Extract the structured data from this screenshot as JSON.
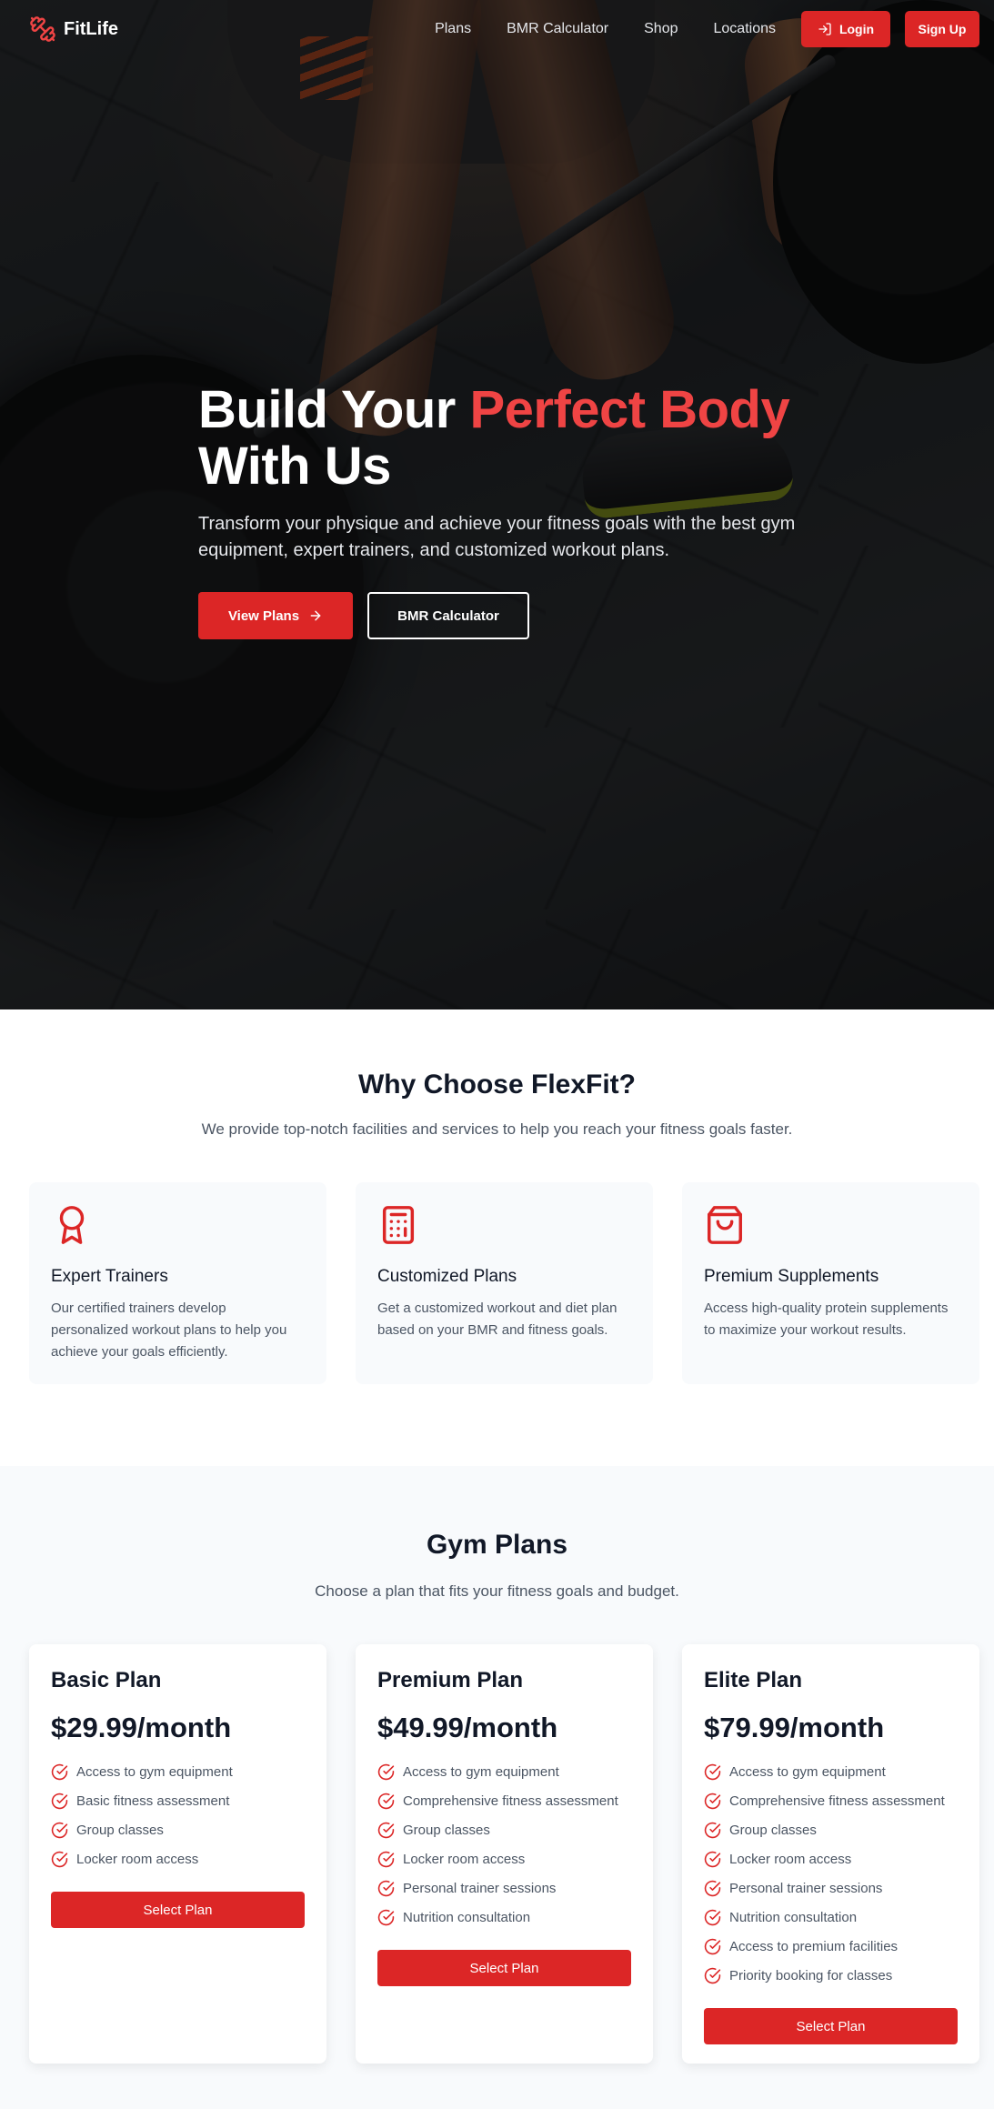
{
  "brand": {
    "name": "FitLife"
  },
  "nav": {
    "links": [
      "Plans",
      "BMR Calculator",
      "Shop",
      "Locations"
    ],
    "login_label": "Login",
    "signup_label": "Sign Up"
  },
  "hero": {
    "title_start": "Build Your ",
    "title_accent": "Perfect Body",
    "title_end": "With Us",
    "subtitle": "Transform your physique and achieve your fitness goals with the best gym equipment, expert trainers, and customized workout plans.",
    "primary_label": "View Plans",
    "secondary_label": "BMR Calculator"
  },
  "features": {
    "title": "Why Choose FlexFit?",
    "subtitle": "We provide top-notch facilities and services to help you reach your fitness goals faster.",
    "items": [
      {
        "icon": "award-icon",
        "title": "Expert Trainers",
        "desc": "Our certified trainers develop personalized workout plans to help you achieve your goals efficiently."
      },
      {
        "icon": "calculator-icon",
        "title": "Customized Plans",
        "desc": "Get a customized workout and diet plan based on your BMR and fitness goals."
      },
      {
        "icon": "shopping-bag-icon",
        "title": "Premium Supplements",
        "desc": "Access high-quality protein supplements to maximize your workout results."
      }
    ]
  },
  "plans": {
    "title": "Gym Plans",
    "subtitle": "Choose a plan that fits your fitness goals and budget.",
    "select_label": "Select Plan",
    "items": [
      {
        "name": "Basic Plan",
        "price": "$29.99/month",
        "features": [
          "Access to gym equipment",
          "Basic fitness assessment",
          "Group classes",
          "Locker room access"
        ]
      },
      {
        "name": "Premium Plan",
        "price": "$49.99/month",
        "features": [
          "Access to gym equipment",
          "Comprehensive fitness assessment",
          "Group classes",
          "Locker room access",
          "Personal trainer sessions",
          "Nutrition consultation"
        ]
      },
      {
        "name": "Elite Plan",
        "price": "$79.99/month",
        "features": [
          "Access to gym equipment",
          "Comprehensive fitness assessment",
          "Group classes",
          "Locker room access",
          "Personal trainer sessions",
          "Nutrition consultation",
          "Access to premium facilities",
          "Priority booking for classes"
        ]
      }
    ]
  },
  "colors": {
    "accent": "#dc2626",
    "accent_light": "#ef4444",
    "heading": "#111827",
    "body": "#4b5563"
  }
}
